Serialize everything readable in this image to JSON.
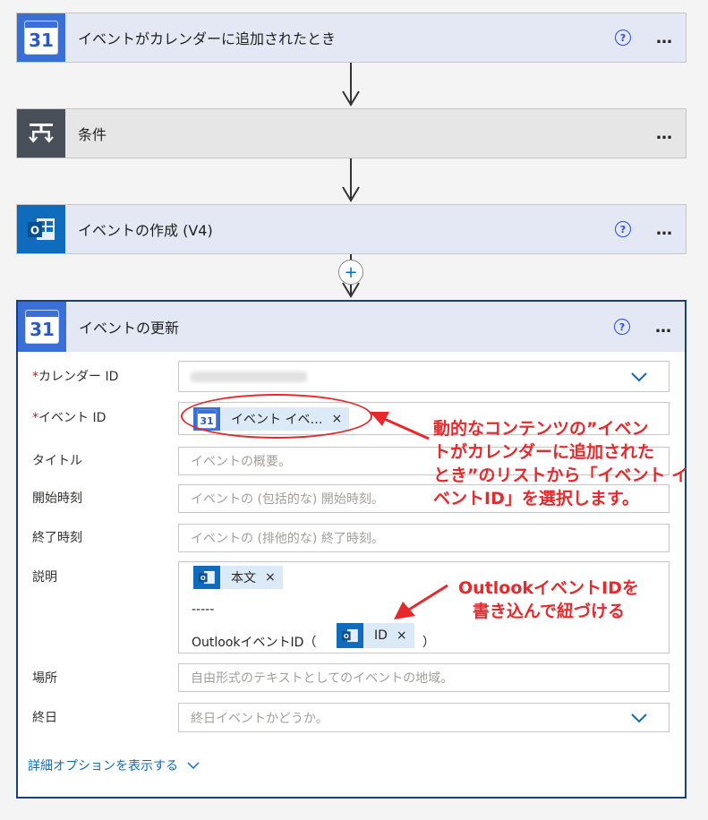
{
  "steps": [
    {
      "title": "イベントがカレンダーに追加されたとき",
      "icon": "google-calendar-icon",
      "icon_text": "31",
      "help": "?",
      "more": "…"
    },
    {
      "title": "条件",
      "icon": "condition-icon",
      "more": "…"
    },
    {
      "title": "イベントの作成 (V4)",
      "icon": "outlook-icon",
      "help": "?",
      "more": "…"
    },
    {
      "title": "イベントの更新",
      "icon": "google-calendar-icon",
      "icon_text": "31",
      "help": "?",
      "more": "…"
    }
  ],
  "insert_button": "+",
  "form": {
    "calendar_id": {
      "label": "カレンダー ID",
      "required": "*"
    },
    "event_id": {
      "label": "イベント ID",
      "required": "*",
      "token_label": "イベント イベ…",
      "token_icon_text": "31",
      "token_remove": "×"
    },
    "title": {
      "label": "タイトル",
      "placeholder": "イベントの概要。"
    },
    "start": {
      "label": "開始時刻",
      "placeholder": "イベントの (包括的な) 開始時刻。"
    },
    "end": {
      "label": "終了時刻",
      "placeholder": "イベントの (排他的な) 終了時刻。"
    },
    "description": {
      "label": "説明",
      "token_body": "本文",
      "token_remove": "×",
      "separator": "-----",
      "outlook_prefix": "OutlookイベントID（",
      "token_id": "ID",
      "close_paren": "）"
    },
    "location": {
      "label": "場所",
      "placeholder": "自由形式のテキストとしてのイベントの地域。"
    },
    "all_day": {
      "label": "終日",
      "placeholder": "終日イベントかどうか。"
    },
    "advanced_link": "詳細オプションを表示する"
  },
  "annotations": {
    "top": [
      "動的なコンテンツの”イベン",
      "トがカレンダーに追加された",
      "とき”のリストから「イベント イ",
      "ベントID」を選択します。"
    ],
    "bottom": [
      "OutlookイベントIDを",
      "書き込んで紐づける"
    ]
  },
  "colors": {
    "header_gray": "#e6e6e6",
    "header_lavender": "#e4e8f4",
    "outlook_blue": "#0f6cbd",
    "link_blue": "#0f6cbd",
    "annotation_red": "#e8292c",
    "active_border": "#1a3f7f"
  }
}
